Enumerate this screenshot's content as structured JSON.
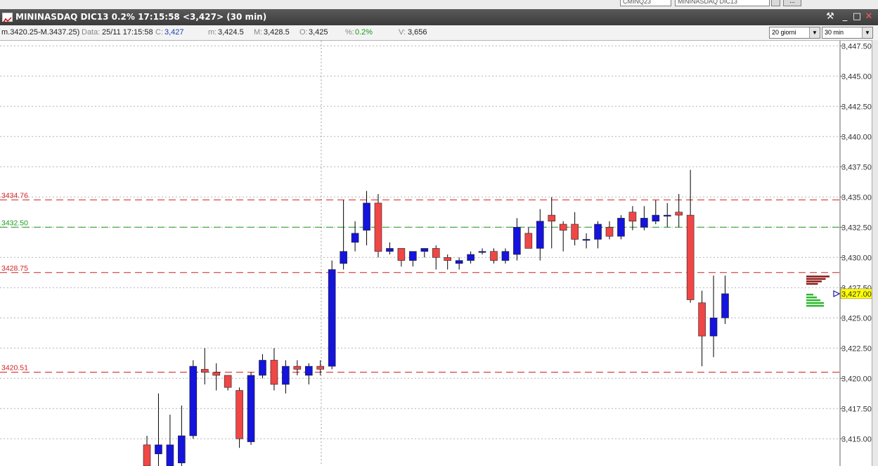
{
  "top_fields": {
    "symbol_box": "CMINQ23",
    "name_box": "MININASDAQ DIC13",
    "button": "..."
  },
  "window": {
    "title": "MININASDAQ DIC13 0.2% 17:15:58  <3,427> (30 min)",
    "icon": "chart-window-icon",
    "controls": {
      "pin": "⚒",
      "minimize": "_",
      "maximize": "□",
      "close": "✕"
    }
  },
  "info": {
    "range": "m.3420.25-M.3437.25)",
    "data_label": "Data:",
    "data_value": "25/11 17:15:58",
    "close_label": "C:",
    "close_value": "3,427",
    "min_label": "m:",
    "min_value": "3,424.5",
    "max_label": "M:",
    "max_value": "3,428.5",
    "open_label": "O:",
    "open_value": "3,425",
    "pct_label": "%:",
    "pct_value": "0.2%",
    "vol_label": "V:",
    "vol_value": "3,656"
  },
  "selectors": {
    "period": "20 giorni",
    "interval": "30 min"
  },
  "chart_data": {
    "type": "candlestick",
    "ylim": [
      3412.75,
      3449.75
    ],
    "y_ticks": [
      "3,415.00",
      "3,417.50",
      "3,420.00",
      "3,422.50",
      "3,425.00",
      "3,427.50",
      "3,430.00",
      "3,432.50",
      "3,435.00",
      "3,437.50",
      "3,440.00",
      "3,442.50",
      "3,445.00",
      "3,447.50"
    ],
    "current_price_label": "3,427.00",
    "current_price": 3427.0,
    "levels": [
      {
        "label": "3434.76",
        "value": 3434.76,
        "color": "#d12020",
        "dash": "long"
      },
      {
        "label": "3432.50",
        "value": 3432.5,
        "color": "#1a9a1a",
        "dash": "long"
      },
      {
        "label": "3428.75",
        "value": 3428.75,
        "color": "#d12020",
        "dash": "long"
      },
      {
        "label": "3420.51",
        "value": 3420.51,
        "color": "#d12020",
        "dash": "long"
      }
    ],
    "session_break_index": 16,
    "candles": [
      {
        "o": 3414.5,
        "h": 3415.25,
        "l": 3412.75,
        "c": 3412.75
      },
      {
        "o": 3413.75,
        "h": 3418.75,
        "l": 3412.75,
        "c": 3414.5
      },
      {
        "o": 3412.75,
        "h": 3417.0,
        "l": 3412.75,
        "c": 3414.5
      },
      {
        "o": 3413.0,
        "h": 3417.75,
        "l": 3412.75,
        "c": 3415.25
      },
      {
        "o": 3415.25,
        "h": 3421.5,
        "l": 3415.0,
        "c": 3421.0
      },
      {
        "o": 3420.75,
        "h": 3422.5,
        "l": 3419.5,
        "c": 3420.5
      },
      {
        "o": 3420.5,
        "h": 3421.25,
        "l": 3419.0,
        "c": 3420.25
      },
      {
        "o": 3420.25,
        "h": 3420.25,
        "l": 3419.0,
        "c": 3419.25
      },
      {
        "o": 3419.0,
        "h": 3419.25,
        "l": 3414.25,
        "c": 3415.0
      },
      {
        "o": 3414.75,
        "h": 3420.5,
        "l": 3414.5,
        "c": 3420.25
      },
      {
        "o": 3420.25,
        "h": 3422.0,
        "l": 3420.0,
        "c": 3421.5
      },
      {
        "o": 3421.5,
        "h": 3422.5,
        "l": 3419.0,
        "c": 3419.5
      },
      {
        "o": 3419.5,
        "h": 3421.5,
        "l": 3418.75,
        "c": 3421.0
      },
      {
        "o": 3421.0,
        "h": 3421.5,
        "l": 3420.25,
        "c": 3420.75
      },
      {
        "o": 3420.25,
        "h": 3421.25,
        "l": 3419.5,
        "c": 3421.0
      },
      {
        "o": 3421.0,
        "h": 3421.5,
        "l": 3420.25,
        "c": 3420.75
      },
      {
        "o": 3421.0,
        "h": 3429.75,
        "l": 3420.75,
        "c": 3429.0
      },
      {
        "o": 3429.5,
        "h": 3434.75,
        "l": 3429.0,
        "c": 3430.5
      },
      {
        "o": 3431.25,
        "h": 3433.0,
        "l": 3430.5,
        "c": 3432.0
      },
      {
        "o": 3432.25,
        "h": 3435.5,
        "l": 3431.0,
        "c": 3434.5
      },
      {
        "o": 3434.5,
        "h": 3435.25,
        "l": 3430.0,
        "c": 3430.5
      },
      {
        "o": 3430.5,
        "h": 3431.25,
        "l": 3430.25,
        "c": 3430.75
      },
      {
        "o": 3430.75,
        "h": 3430.75,
        "l": 3429.25,
        "c": 3429.75
      },
      {
        "o": 3429.75,
        "h": 3430.5,
        "l": 3429.25,
        "c": 3430.5
      },
      {
        "o": 3430.5,
        "h": 3430.75,
        "l": 3430.0,
        "c": 3430.75
      },
      {
        "o": 3430.75,
        "h": 3431.0,
        "l": 3429.0,
        "c": 3430.0
      },
      {
        "o": 3430.0,
        "h": 3430.25,
        "l": 3429.0,
        "c": 3429.75
      },
      {
        "o": 3429.5,
        "h": 3430.0,
        "l": 3429.0,
        "c": 3429.75
      },
      {
        "o": 3429.75,
        "h": 3430.5,
        "l": 3429.5,
        "c": 3430.25
      },
      {
        "o": 3430.5,
        "h": 3430.75,
        "l": 3430.25,
        "c": 3430.5
      },
      {
        "o": 3430.5,
        "h": 3430.75,
        "l": 3429.5,
        "c": 3429.75
      },
      {
        "o": 3429.75,
        "h": 3430.75,
        "l": 3429.5,
        "c": 3430.5
      },
      {
        "o": 3430.25,
        "h": 3433.25,
        "l": 3429.75,
        "c": 3432.5
      },
      {
        "o": 3432.0,
        "h": 3432.5,
        "l": 3430.75,
        "c": 3430.75
      },
      {
        "o": 3430.75,
        "h": 3434.0,
        "l": 3429.75,
        "c": 3433.0
      },
      {
        "o": 3433.5,
        "h": 3435.0,
        "l": 3430.75,
        "c": 3433.0
      },
      {
        "o": 3432.75,
        "h": 3433.0,
        "l": 3430.5,
        "c": 3432.25
      },
      {
        "o": 3432.75,
        "h": 3433.75,
        "l": 3431.0,
        "c": 3431.5
      },
      {
        "o": 3431.5,
        "h": 3432.0,
        "l": 3430.75,
        "c": 3431.5
      },
      {
        "o": 3431.5,
        "h": 3433.0,
        "l": 3430.75,
        "c": 3432.75
      },
      {
        "o": 3432.5,
        "h": 3433.0,
        "l": 3431.5,
        "c": 3431.75
      },
      {
        "o": 3431.75,
        "h": 3433.5,
        "l": 3431.5,
        "c": 3433.25
      },
      {
        "o": 3433.75,
        "h": 3434.25,
        "l": 3432.25,
        "c": 3433.0
      },
      {
        "o": 3432.5,
        "h": 3434.25,
        "l": 3432.25,
        "c": 3433.25
      },
      {
        "o": 3433.0,
        "h": 3434.75,
        "l": 3432.75,
        "c": 3433.5
      },
      {
        "o": 3433.5,
        "h": 3434.5,
        "l": 3432.5,
        "c": 3433.5
      },
      {
        "o": 3433.75,
        "h": 3435.25,
        "l": 3432.5,
        "c": 3433.5
      },
      {
        "o": 3433.5,
        "h": 3437.25,
        "l": 3426.25,
        "c": 3426.5
      },
      {
        "o": 3426.25,
        "h": 3427.25,
        "l": 3421.0,
        "c": 3423.5
      },
      {
        "o": 3423.5,
        "h": 3428.5,
        "l": 3421.75,
        "c": 3425.0
      },
      {
        "o": 3425.0,
        "h": 3428.5,
        "l": 3424.5,
        "c": 3427.0
      }
    ],
    "order_book": {
      "asks": [
        6,
        5,
        4,
        3
      ],
      "bids": [
        2,
        3,
        4,
        5,
        5
      ]
    },
    "colors": {
      "up": "#1414dc",
      "down": "#f04646",
      "wick": "#000000",
      "grid": "#b4b4b4",
      "current_bg": "#ffff00"
    }
  }
}
